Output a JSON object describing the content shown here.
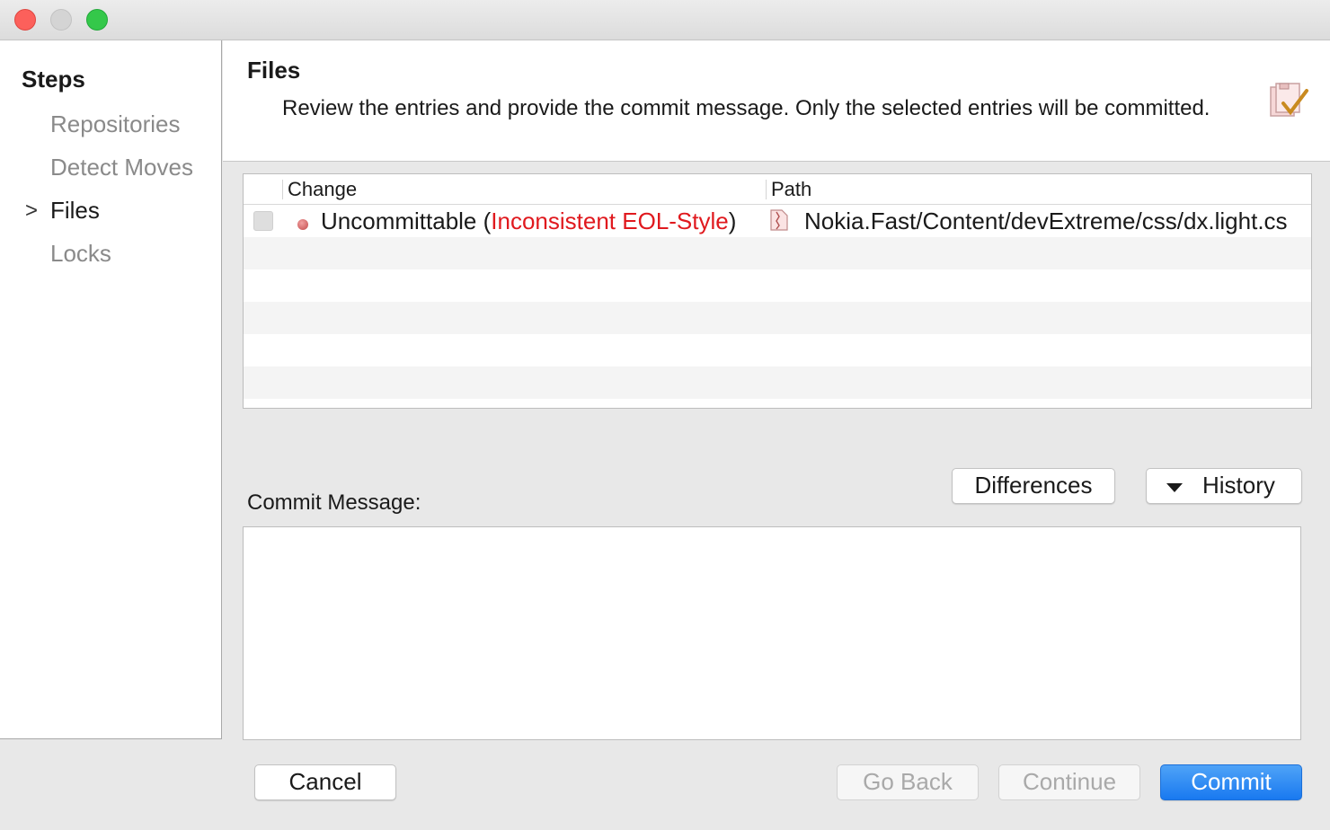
{
  "window": {
    "buttons": {
      "close": "close",
      "minimize": "minimize",
      "maximize": "maximize"
    }
  },
  "sidebar": {
    "title": "Steps",
    "items": [
      {
        "label": "Repositories",
        "active": false
      },
      {
        "label": "Detect Moves",
        "active": false
      },
      {
        "label": "Files",
        "active": true
      },
      {
        "label": "Locks",
        "active": false
      }
    ],
    "current_marker": ">"
  },
  "header": {
    "title": "Files",
    "description": "Review the entries and provide the commit message. Only the selected entries will be committed.",
    "icon": "commit-checklist-icon"
  },
  "files_table": {
    "columns": [
      "Change",
      "Path"
    ],
    "rows": [
      {
        "checked": false,
        "status_icon": "red-dot-icon",
        "change_prefix": "Uncommittable (",
        "change_reason": "Inconsistent EOL-Style",
        "change_suffix": ")",
        "file_icon": "file-conflict-icon",
        "path": "Nokia.Fast/Content/devExtreme/css/dx.light.cs"
      }
    ]
  },
  "actions": {
    "differences": "Differences",
    "history": "History"
  },
  "commit": {
    "label": "Commit Message:",
    "message": ""
  },
  "footer": {
    "cancel": "Cancel",
    "go_back": "Go Back",
    "continue": "Continue",
    "commit": "Commit"
  },
  "colors": {
    "error_text": "#e0191e",
    "primary_button": "#1979f0",
    "sidebar_inactive": "#8a8a8a"
  }
}
